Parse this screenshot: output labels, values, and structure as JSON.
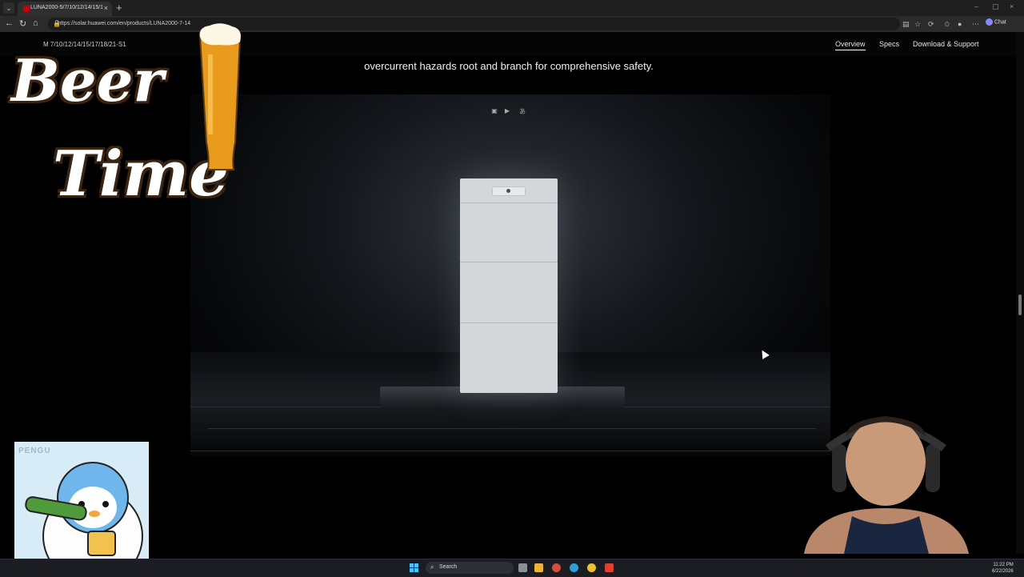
{
  "browser": {
    "tab_title": "LUNA2000-5/7/10/12/14/15/17/1",
    "tab_close": "×",
    "new_tab": "+",
    "url": "https://solar.huawei.com/en/products/LUNA2000-7-14",
    "chat_label": "Chat",
    "window_controls": [
      "–",
      "▢",
      "×"
    ]
  },
  "site_nav": {
    "product_name": "M     7/10/12/14/15/17/18/21-S1",
    "links": [
      "Overview",
      "Specs",
      "Download & Support"
    ],
    "active": "Overview"
  },
  "main": {
    "heading": "overcurrent hazards root and branch for comprehensive safety."
  },
  "overlay": {
    "beer_line1": "Beer",
    "beer_line2": "Time",
    "pengu_label": "PENGU"
  },
  "taskbar": {
    "search_placeholder": "Search",
    "time": "11:22 PM",
    "date": "6/22/2026"
  },
  "colors": {
    "accent": "#c7000b",
    "battery": "#d4d6d9",
    "taskbar": "#1b1d22"
  }
}
